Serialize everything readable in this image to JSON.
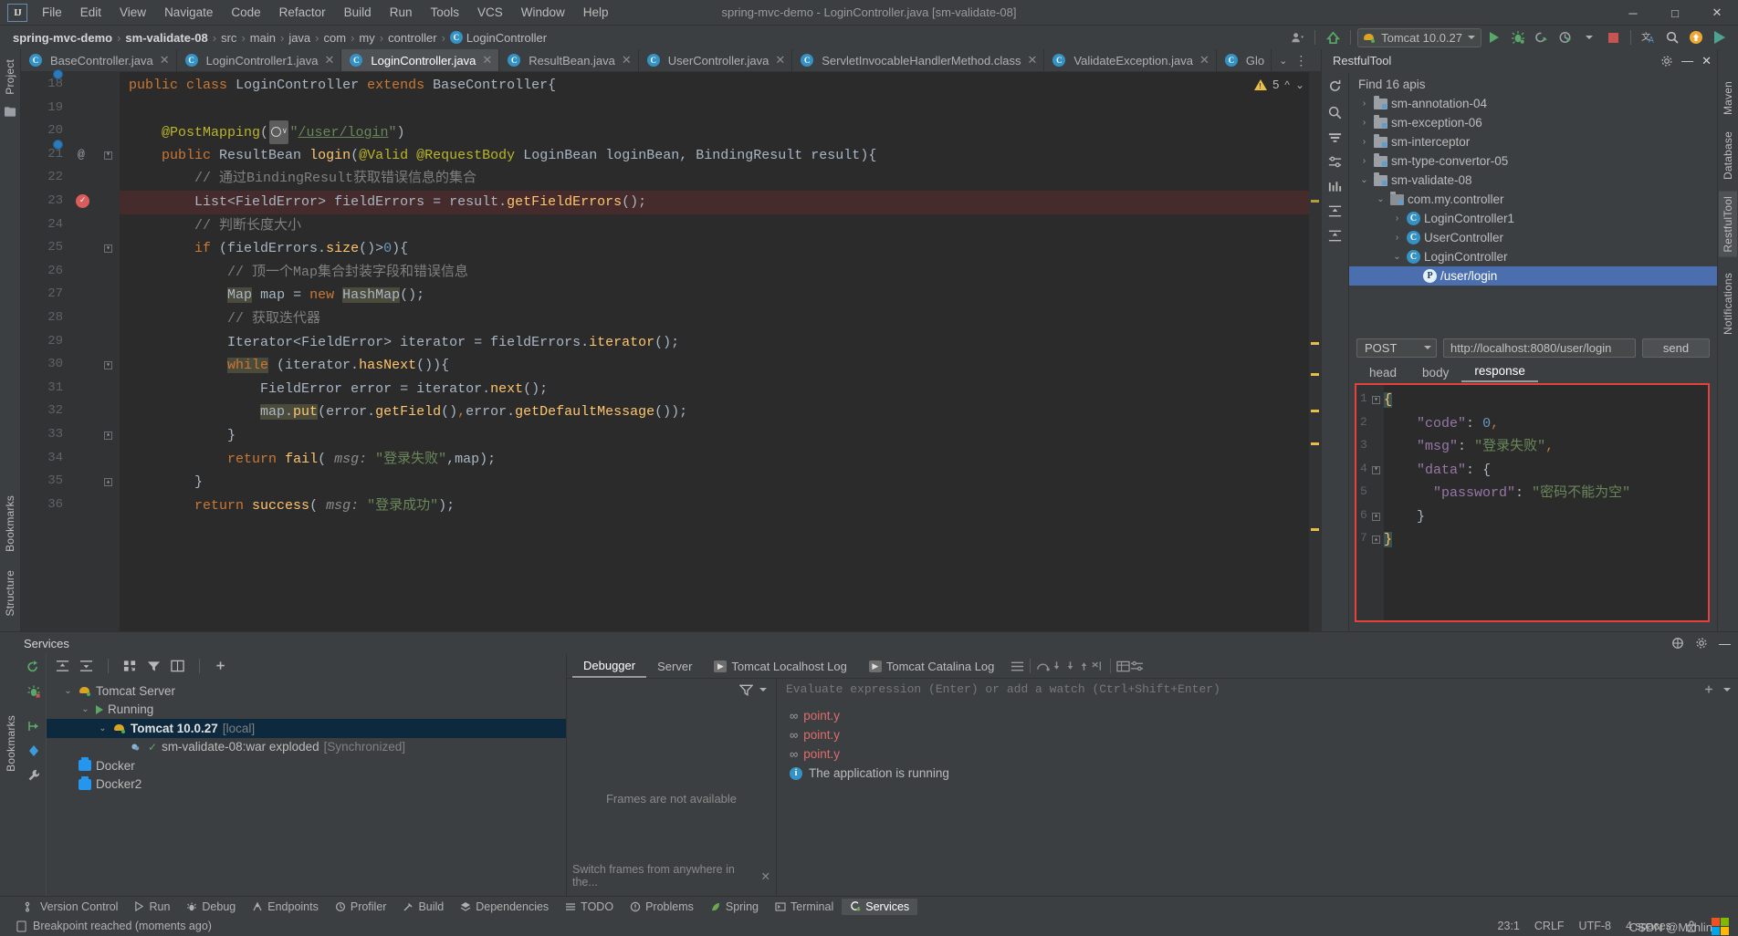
{
  "window": {
    "title": "spring-mvc-demo - LoginController.java [sm-validate-08]",
    "minimize": "─",
    "maximize": "□",
    "close": "✕",
    "logo": "IJ"
  },
  "menubar": {
    "items": [
      "File",
      "Edit",
      "View",
      "Navigate",
      "Code",
      "Refactor",
      "Build",
      "Run",
      "Tools",
      "VCS",
      "Window",
      "Help"
    ]
  },
  "breadcrumb": {
    "items": [
      "spring-mvc-demo",
      "sm-validate-08",
      "src",
      "main",
      "java",
      "com",
      "my",
      "controller",
      "LoginController"
    ],
    "separator": "›",
    "class_icon": "C"
  },
  "toolbar": {
    "run_config": "Tomcat 10.0.27",
    "run_label": "Run",
    "debug_label": "Debug",
    "rerun_label": "Rerun",
    "coverage_label": "Run with Coverage",
    "stop_label": "Stop",
    "translate_label": "Translate",
    "search_label": "Search Everywhere",
    "update_label": "Update Project",
    "notify_label": "Notifications"
  },
  "editor_tabs": [
    {
      "label": "BaseController.java",
      "icon": "class-icon",
      "active": false
    },
    {
      "label": "LoginController1.java",
      "icon": "class-icon",
      "active": false
    },
    {
      "label": "LoginController.java",
      "icon": "class-icon",
      "active": true
    },
    {
      "label": "ResultBean.java",
      "icon": "class-icon",
      "active": false
    },
    {
      "label": "UserController.java",
      "icon": "class-icon",
      "active": false
    },
    {
      "label": "ServletInvocableHandlerMethod.class",
      "icon": "class-icon",
      "active": false
    },
    {
      "label": "ValidateException.java",
      "icon": "class-icon",
      "active": false
    },
    {
      "label": "Glo",
      "icon": "class-icon",
      "active": false
    }
  ],
  "editor": {
    "warning_count": "5",
    "warning_icon": "warning-triangle-icon",
    "lines": [
      {
        "num": "18",
        "marker": "override-bead",
        "fold": "",
        "text_html": "<span class=\"kw\">public</span> <span class=\"kw\">class</span> <span class=\"cls\">LoginController</span> <span class=\"kw\">extends</span> <span class=\"cls\">BaseController</span>{"
      },
      {
        "num": "19",
        "marker": "",
        "fold": "",
        "text_html": ""
      },
      {
        "num": "20",
        "marker": "",
        "fold": "",
        "text_html": "    <span class=\"ann\">@PostMapping</span>(<span class=\"world-ico\"><span class=\"globe\"></span><span style=\"font-size:9px;color:#d0d0d0\">∨</span></span><span class=\"str\">\"</span><span class=\"linkstr\">/user/login</span><span class=\"str\">\"</span>)"
      },
      {
        "num": "21",
        "marker": "override-bead-at",
        "fold": "fold-open",
        "text_html": "    <span class=\"kw\">public</span> <span class=\"cls\">ResultBean</span> <span class=\"fn\">login</span>(<span class=\"ann\">@Valid</span> <span class=\"ann\">@RequestBody</span> <span class=\"cls\">LoginBean</span> <span class=\"param\">loginBean</span>, <span class=\"cls\">BindingResult</span> <span class=\"param\">result</span>){"
      },
      {
        "num": "22",
        "marker": "",
        "fold": "",
        "text_html": "        <span class=\"cmt\">// 通过BindingResult获取错误信息的集合</span>"
      },
      {
        "num": "23",
        "marker": "breakpoint",
        "fold": "",
        "highlight": true,
        "text_html": "        <span class=\"cls\">List</span>&lt;<span class=\"cls\">FieldError</span>&gt; <span class=\"param\">fieldErrors</span> = result.<span class=\"fn\">getFieldErrors</span>();"
      },
      {
        "num": "24",
        "marker": "",
        "fold": "",
        "text_html": "        <span class=\"cmt\">// 判断长度大小</span>"
      },
      {
        "num": "25",
        "marker": "",
        "fold": "fold-open",
        "text_html": "        <span class=\"kw\">if</span> (fieldErrors.<span class=\"fn\">size</span>()&gt;<span class=\"num\">0</span>){"
      },
      {
        "num": "26",
        "marker": "",
        "fold": "",
        "text_html": "            <span class=\"cmt\">// 顶一个Map集合封装字段和错误信息</span>"
      },
      {
        "num": "27",
        "marker": "",
        "fold": "",
        "text_html": "            <span class=\"hlword cls\">Map</span> <span class=\"param\">map</span> = <span class=\"kw\">new</span> <span class=\"hlword cls\">HashMap</span>();"
      },
      {
        "num": "28",
        "marker": "",
        "fold": "",
        "text_html": "            <span class=\"cmt\">// 获取迭代器</span>"
      },
      {
        "num": "29",
        "marker": "",
        "fold": "",
        "text_html": "            <span class=\"cls\">Iterator</span>&lt;<span class=\"cls\">FieldError</span>&gt; <span class=\"param\">iterator</span> = fieldErrors.<span class=\"fn\">iterator</span>();"
      },
      {
        "num": "30",
        "marker": "",
        "fold": "fold-open",
        "text_html": "            <span class=\"hlword kw\">while</span> (iterator.<span class=\"fn\">hasNext</span>()){"
      },
      {
        "num": "31",
        "marker": "",
        "fold": "",
        "text_html": "                <span class=\"cls\">FieldError</span> <span class=\"param\">error</span> = iterator.<span class=\"fn\">next</span>();"
      },
      {
        "num": "32",
        "marker": "",
        "fold": "",
        "text_html": "                <span class=\"hlword\">map.<span class=\"fn\">put</span></span>(error.<span class=\"fn\">getField</span>()<span class=\"kw\">,</span>error.<span class=\"fn\">getDefaultMessage</span>());"
      },
      {
        "num": "33",
        "marker": "",
        "fold": "fold-close",
        "text_html": "            }"
      },
      {
        "num": "34",
        "marker": "",
        "fold": "",
        "text_html": "            <span class=\"kw\">return</span> <span class=\"fn\">fail</span>( <span class=\"hint\">msg:</span> <span class=\"str\">\"登录失败\"</span>,map);"
      },
      {
        "num": "35",
        "marker": "",
        "fold": "fold-close",
        "text_html": "        }"
      },
      {
        "num": "36",
        "marker": "",
        "fold": "",
        "text_html": "        <span class=\"kw\">return</span> <span class=\"fn\">success</span>( <span class=\"hint\">msg:</span> <span class=\"str\">\"登录成功\"</span>);"
      }
    ]
  },
  "restful": {
    "title": "RestfulTool",
    "find_label": "Find 16 apis",
    "icons": [
      "refresh-icon",
      "search-icon",
      "filter-icon",
      "settings-sliders-icon",
      "chart-icon",
      "expand-all-icon",
      "collapse-all-icon"
    ],
    "tree": [
      {
        "label": "sm-annotation-04",
        "icon": "folder-icon",
        "arrow": "›",
        "indent": 0,
        "selected": false
      },
      {
        "label": "sm-exception-06",
        "icon": "folder-icon",
        "arrow": "›",
        "indent": 0,
        "selected": false
      },
      {
        "label": "sm-interceptor",
        "icon": "folder-icon",
        "arrow": "›",
        "indent": 0,
        "selected": false
      },
      {
        "label": "sm-type-convertor-05",
        "icon": "folder-icon",
        "arrow": "›",
        "indent": 0,
        "selected": false
      },
      {
        "label": "sm-validate-08",
        "icon": "folder-icon",
        "arrow": "⌄",
        "indent": 0,
        "selected": false
      },
      {
        "label": "com.my.controller",
        "icon": "package-icon",
        "arrow": "⌄",
        "indent": 1,
        "selected": false
      },
      {
        "label": "LoginController1",
        "icon": "class-icon",
        "arrow": "›",
        "indent": 2,
        "selected": false
      },
      {
        "label": "UserController",
        "icon": "class-icon",
        "arrow": "›",
        "indent": 2,
        "selected": false
      },
      {
        "label": "LoginController",
        "icon": "class-icon",
        "arrow": "⌄",
        "indent": 2,
        "selected": false
      },
      {
        "label": "/user/login",
        "icon": "post-method-icon",
        "arrow": "",
        "indent": 3,
        "selected": true
      }
    ],
    "request": {
      "method": "POST",
      "method_caret": "▼",
      "url": "http://localhost:8080/user/login",
      "send_label": "send"
    },
    "tabs": [
      {
        "label": "head",
        "selected": false
      },
      {
        "label": "body",
        "selected": false
      },
      {
        "label": "response",
        "selected": true
      }
    ],
    "response": {
      "border_color": "#e8403a",
      "lines": [
        {
          "num": "1",
          "fold": "open",
          "html": "<span class=\"jbrace-hl\">{</span>"
        },
        {
          "num": "2",
          "fold": "",
          "html": "    <span class=\"jk\">\"code\"</span><span class=\"jbrace\">:</span> <span class=\"jnum\">0</span><span class=\"jcomma\">,</span>"
        },
        {
          "num": "3",
          "fold": "",
          "html": "    <span class=\"jk\">\"msg\"</span><span class=\"jbrace\">:</span> <span class=\"jstr\">\"登录失败\"</span><span class=\"jcomma\">,</span>"
        },
        {
          "num": "4",
          "fold": "open",
          "html": "    <span class=\"jk\">\"data\"</span><span class=\"jbrace\">:</span> <span class=\"jbrace\">{</span>"
        },
        {
          "num": "5",
          "fold": "",
          "html": "      <span class=\"jk\">\"password\"</span><span class=\"jbrace\">:</span> <span class=\"jstr\">\"密码不能为空\"</span>"
        },
        {
          "num": "6",
          "fold": "close",
          "html": "    <span class=\"jbrace\">}</span>"
        },
        {
          "num": "7",
          "fold": "close",
          "html": "<span class=\"jbrace-hl\">}</span>"
        }
      ],
      "raw": {
        "code": 0,
        "msg": "登录失败",
        "data": {
          "password": "密码不能为空"
        }
      }
    }
  },
  "left_rail": {
    "items": [
      "Project",
      "Bookmarks",
      "Structure"
    ]
  },
  "right_rail": {
    "items": [
      "Maven",
      "Database",
      "RestfulTool",
      "Notifications"
    ]
  },
  "services": {
    "title": "Services",
    "toolbar_icons": [
      "expand-all-icon",
      "collapse-all-icon",
      "group-icon",
      "filter-icon",
      "show-options-icon",
      "add-icon"
    ],
    "tree": [
      {
        "label": "Tomcat Server",
        "arrow": "⌄",
        "icon": "tomcat-icon",
        "indent": 0,
        "selected": false,
        "bold": false,
        "suffix": ""
      },
      {
        "label": "Running",
        "arrow": "⌄",
        "icon": "run-icon",
        "indent": 1,
        "selected": false,
        "bold": false,
        "suffix": ""
      },
      {
        "label": "Tomcat 10.0.27",
        "arrow": "⌄",
        "icon": "tomcat-icon",
        "indent": 2,
        "selected": true,
        "bold": true,
        "suffix": "[local]"
      },
      {
        "label": "sm-validate-08:war exploded",
        "arrow": "",
        "icon": "artifact-check-icon",
        "indent": 3,
        "selected": false,
        "bold": false,
        "suffix": "[Synchronized]"
      },
      {
        "label": "Docker",
        "arrow": "",
        "icon": "docker-icon",
        "indent": 0,
        "selected": false,
        "bold": false,
        "suffix": ""
      },
      {
        "label": "Docker2",
        "arrow": "",
        "icon": "docker-icon",
        "indent": 0,
        "selected": false,
        "bold": false,
        "suffix": ""
      }
    ]
  },
  "debugger": {
    "tabs": [
      {
        "label": "Debugger",
        "icon": "",
        "selected": true
      },
      {
        "label": "Server",
        "icon": "",
        "selected": false
      },
      {
        "label": "Tomcat Localhost Log",
        "icon": "console-icon",
        "selected": false
      },
      {
        "label": "Tomcat Catalina Log",
        "icon": "console-icon",
        "selected": false
      }
    ],
    "frames_placeholder": "Frames are not available",
    "frames_note": "Switch frames from anywhere in the...",
    "frames_note_close": "✕",
    "evaluate_placeholder": "Evaluate expression (Enter) or add a watch (Ctrl+Shift+Enter)",
    "watches": [
      {
        "icon": "watch-glasses-icon",
        "name": "point.y"
      },
      {
        "icon": "watch-glasses-icon",
        "name": "point.y"
      },
      {
        "icon": "watch-glasses-icon",
        "name": "point.y"
      }
    ],
    "status": {
      "icon": "info-icon",
      "text": "The application is running"
    }
  },
  "toolwindow_bar": [
    {
      "label": "Version Control",
      "icon": "branch-icon",
      "selected": false
    },
    {
      "label": "Run",
      "icon": "play-icon",
      "selected": false
    },
    {
      "label": "Debug",
      "icon": "bug-icon",
      "selected": false
    },
    {
      "label": "Endpoints",
      "icon": "endpoints-icon",
      "selected": false
    },
    {
      "label": "Profiler",
      "icon": "profiler-icon",
      "selected": false
    },
    {
      "label": "Build",
      "icon": "hammer-icon",
      "selected": false
    },
    {
      "label": "Dependencies",
      "icon": "layers-icon",
      "selected": false
    },
    {
      "label": "TODO",
      "icon": "list-icon",
      "selected": false
    },
    {
      "label": "Problems",
      "icon": "problems-icon",
      "selected": false
    },
    {
      "label": "Spring",
      "icon": "spring-leaf-icon",
      "selected": false
    },
    {
      "label": "Terminal",
      "icon": "terminal-icon",
      "selected": false
    },
    {
      "label": "Services",
      "icon": "services-icon",
      "selected": true
    }
  ],
  "statusbar": {
    "message_icon": "document-icon",
    "message": "Breakpoint reached (moments ago)",
    "caret": "23:1",
    "line_sep": "CRLF",
    "encoding": "UTF-8",
    "indent": "4 spaces",
    "lock_icon": "lock-icon",
    "watermark": "CSDN @Mxhlin"
  }
}
